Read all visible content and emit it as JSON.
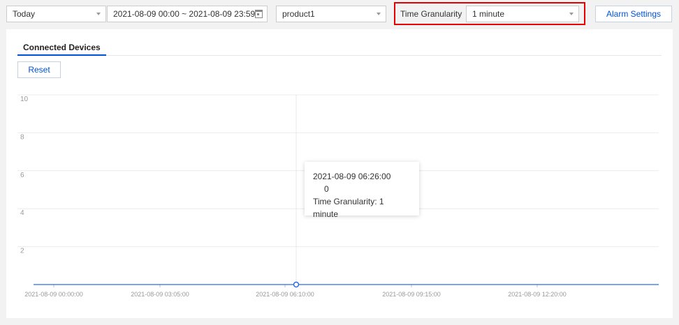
{
  "toolbar": {
    "period": "Today",
    "date_range": "2021-08-09 00:00 ~ 2021-08-09 23:59",
    "product": "product1",
    "granularity_label": "Time Granularity",
    "granularity_value": "1 minute",
    "alarm_button": "Alarm Settings"
  },
  "panel": {
    "tab": "Connected Devices",
    "reset_button": "Reset"
  },
  "tooltip": {
    "time": "2021-08-09 06:26:00",
    "value": "0",
    "granularity": "Time Granularity: 1 minute"
  },
  "colors": {
    "accent": "#0052d9",
    "highlight": "#e60000",
    "series": "#2f6be0"
  },
  "chart_data": {
    "type": "line",
    "title": "",
    "xlabel": "",
    "ylabel": "",
    "ylim": [
      0,
      10
    ],
    "yticks": [
      2,
      4,
      6,
      8,
      10
    ],
    "x_tick_labels": [
      "2021-08-09 00:00:00",
      "2021-08-09 03:05:00",
      "2021-08-09 06:10:00",
      "2021-08-09 09:15:00",
      "2021-08-09 12:20:00"
    ],
    "series": [
      {
        "values": [
          0,
          0,
          0,
          0,
          0,
          0
        ]
      }
    ],
    "highlight_point": {
      "x": "2021-08-09 06:26:00",
      "y": 0
    },
    "grid": true
  }
}
